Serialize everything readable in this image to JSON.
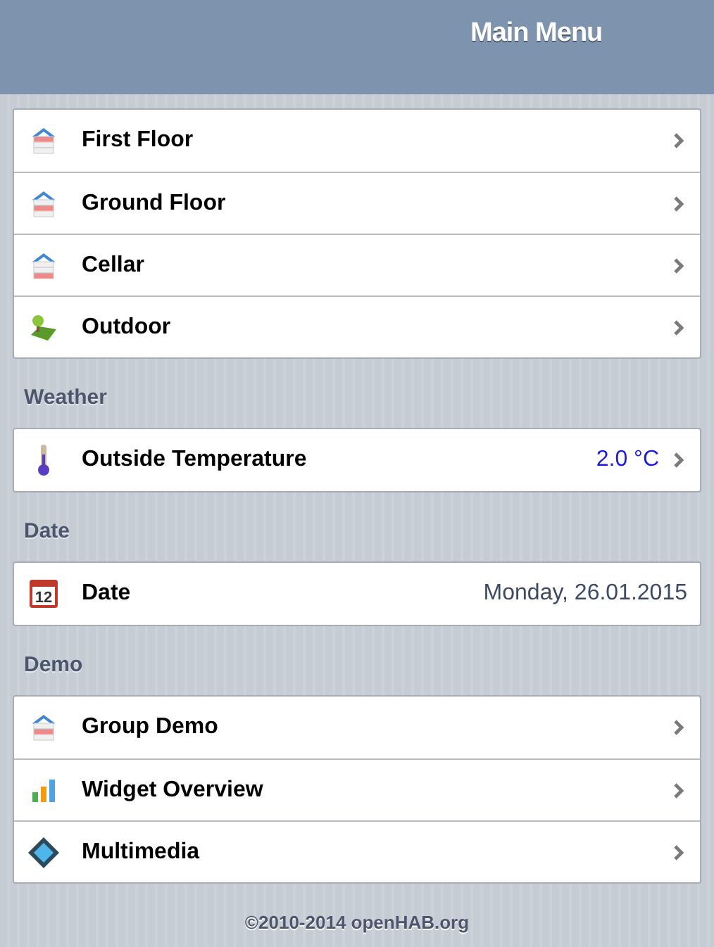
{
  "header": {
    "title": "Main Menu"
  },
  "sections": [
    {
      "items": [
        {
          "label": "First Floor",
          "kind": "link"
        },
        {
          "label": "Ground Floor",
          "kind": "link"
        },
        {
          "label": "Cellar",
          "kind": "link"
        },
        {
          "label": "Outdoor",
          "kind": "link"
        }
      ]
    },
    {
      "label": "Weather",
      "items": [
        {
          "label": "Outside Temperature",
          "kind": "link",
          "value": "2.0 °C"
        }
      ]
    },
    {
      "label": "Date",
      "items": [
        {
          "label": "Date",
          "kind": "text",
          "value": "Monday, 26.01.2015",
          "icon_text": "12"
        }
      ]
    },
    {
      "label": "Demo",
      "items": [
        {
          "label": "Group Demo",
          "kind": "link"
        },
        {
          "label": "Widget Overview",
          "kind": "link"
        },
        {
          "label": "Multimedia",
          "kind": "link"
        }
      ]
    }
  ],
  "footer": "©2010-2014 openHAB.org"
}
